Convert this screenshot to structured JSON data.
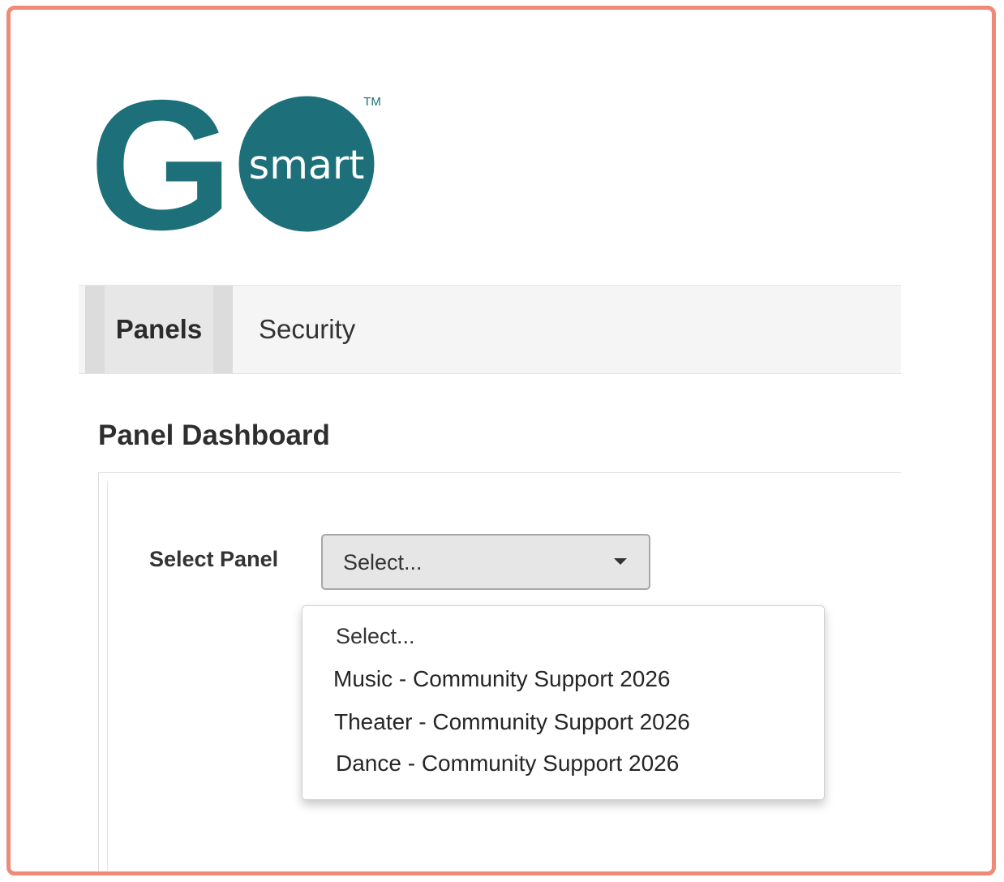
{
  "logo": {
    "letter": "G",
    "word": "smart",
    "trademark": "TM",
    "color": "#1d7079"
  },
  "nav": {
    "tabs": [
      {
        "label": "Panels",
        "active": true
      },
      {
        "label": "Security",
        "active": false
      }
    ]
  },
  "page": {
    "title": "Panel Dashboard"
  },
  "panel_select": {
    "label": "Select Panel",
    "value": "Select...",
    "options": [
      "Select...",
      "Music - Community Support 2026",
      "Theater - Community Support 2026",
      "Dance - Community Support 2026"
    ]
  },
  "colors": {
    "frame_border": "#f08a77",
    "brand_teal": "#1d7079"
  }
}
